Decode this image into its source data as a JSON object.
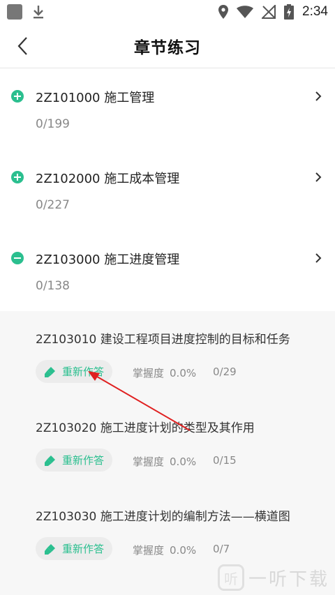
{
  "status_bar": {
    "time": "2:34"
  },
  "header": {
    "title": "章节练习"
  },
  "chapters": [
    {
      "title": "2Z101000 施工管理",
      "progress": "0/199",
      "state": "collapsed"
    },
    {
      "title": "2Z102000 施工成本管理",
      "progress": "0/227",
      "state": "collapsed"
    },
    {
      "title": "2Z103000 施工进度管理",
      "progress": "0/138",
      "state": "expanded"
    }
  ],
  "sections": [
    {
      "title": "2Z103010 建设工程项目进度控制的目标和任务",
      "redo_label": "重新作答",
      "mastery_label": "掌握度",
      "mastery_value": "0.0%",
      "count": "0/29"
    },
    {
      "title": "2Z103020 施工进度计划的类型及其作用",
      "redo_label": "重新作答",
      "mastery_label": "掌握度",
      "mastery_value": "0.0%",
      "count": "0/15"
    },
    {
      "title": "2Z103030 施工进度计划的编制方法——横道图",
      "redo_label": "重新作答",
      "mastery_label": "掌握度",
      "mastery_value": "0.0%",
      "count": "0/7"
    }
  ],
  "watermark": {
    "logo": "听",
    "text": "一听下载"
  },
  "colors": {
    "accent": "#2bbf8f",
    "arrow": "#e02020"
  }
}
